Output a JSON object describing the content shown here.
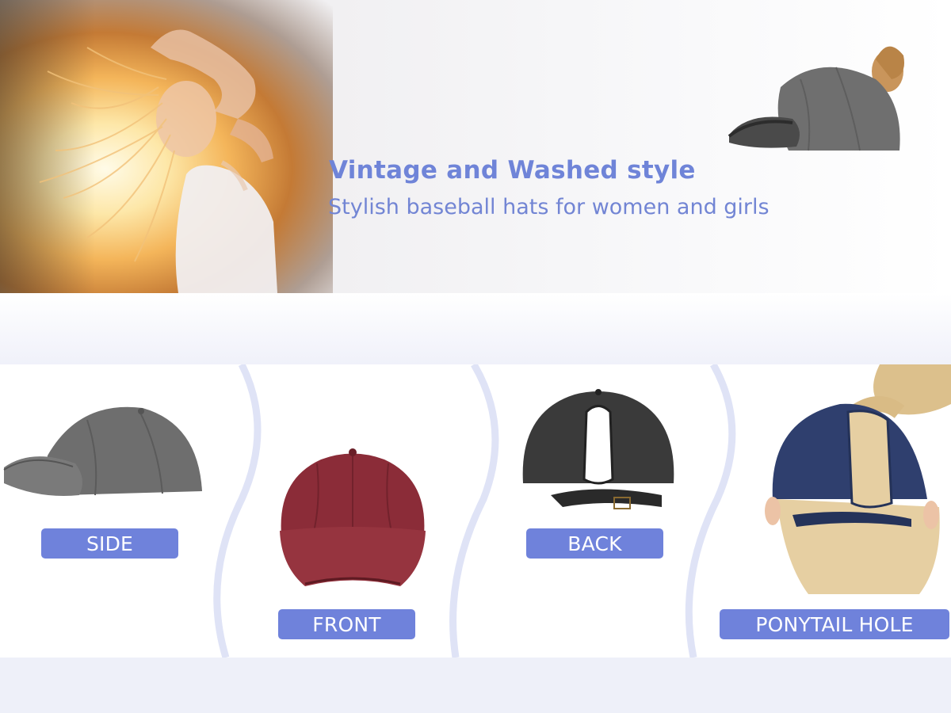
{
  "banner": {
    "title": "Vintage and Washed style",
    "subtitle": "Stylish baseball hats for women and girls",
    "title_color": "#6f84d8",
    "subtitle_color": "#7285d4"
  },
  "views": [
    {
      "label": "SIDE",
      "cap_color": "#6e6e6e"
    },
    {
      "label": "FRONT",
      "cap_color": "#8b2c38"
    },
    {
      "label": "BACK",
      "cap_color": "#3a3a3a"
    },
    {
      "label": "PONYTAIL HOLE",
      "cap_color": "#2f3f6e"
    }
  ],
  "colors": {
    "label_bg": "#6f82db",
    "label_text": "#ffffff",
    "wave": "#dfe3f6",
    "page_bg": "#f3f4fb"
  },
  "icons": [
    "woman-photo",
    "gray-cap-ponytail",
    "gray-cap-side",
    "red-cap-front",
    "black-cap-back",
    "navy-cap-ponytail-model"
  ]
}
